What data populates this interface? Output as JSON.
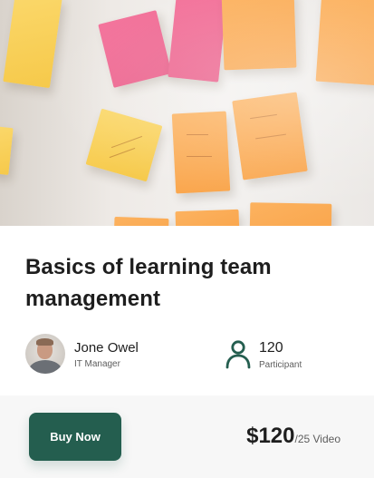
{
  "course": {
    "title_line1": "Basics of learning team",
    "title_line2": "management"
  },
  "instructor": {
    "name": "Jone Owel",
    "role": "IT Manager"
  },
  "participants": {
    "count": "120",
    "label": "Participant",
    "icon": "user-icon"
  },
  "purchase": {
    "button_label": "Buy Now",
    "price": "$120",
    "unit": "/25 Video"
  },
  "colors": {
    "accent": "#245e4f",
    "footer_bg": "#f7f7f7",
    "text": "#1e1e1e",
    "muted": "#5d5d5d"
  }
}
